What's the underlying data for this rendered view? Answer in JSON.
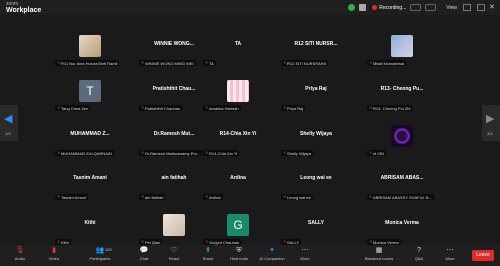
{
  "app": {
    "brand_top": "zoom",
    "brand_bottom": "Workplace"
  },
  "topbar": {
    "recording_label": "Recording...",
    "view_label": "View"
  },
  "colors": {
    "accent": "#2d8cff",
    "muted_mic": "#e23b3b",
    "leave": "#e02b2b",
    "secure": "#2bb24c"
  },
  "pager": {
    "left_page": "1/3",
    "right_page": "3/3"
  },
  "tiles": [
    {
      "center": "",
      "avatar": "photo",
      "label": "R11 Nur Aina Husna Binti Ramli"
    },
    {
      "center": "WINNIE WONG...",
      "avatar": "",
      "label": "WINNIE WONG MING WEI"
    },
    {
      "center": "TA",
      "avatar": "",
      "label": "TA"
    },
    {
      "center": "R12 SITI NURSR...",
      "avatar": "",
      "label": "R12 SITI NURSRAINI"
    },
    {
      "center": "",
      "avatar": "photo",
      "label": "Mitali Khandelwal"
    },
    {
      "center": "",
      "avatar": "T",
      "label": "Tang Chea Zen"
    },
    {
      "center": "Pratishthit Chau...",
      "avatar": "",
      "label": "Pratishthit Chauhan"
    },
    {
      "center": "",
      "avatar": "photo",
      "label": "Amalina Hadirah"
    },
    {
      "center": "Priya Raj",
      "avatar": "",
      "label": "Priya Raj"
    },
    {
      "center": "R13- Cheong Pu...",
      "avatar": "",
      "label": "R13- Cheong Pui Zhi"
    },
    {
      "center": "MUHAMMAD Z...",
      "avatar": "",
      "label": "MUHAMMAD ZULQARNAIN"
    },
    {
      "center": "Dr.Ramesh Mut...",
      "avatar": "",
      "label": "Dr.Ramesh Mathuswamy Pro..."
    },
    {
      "center": "R14-Chia Xin Yi",
      "avatar": "",
      "label": "R14-Chia Xin Yi"
    },
    {
      "center": "Shelly Wijaya",
      "avatar": "",
      "label": "Shelly Wijaya"
    },
    {
      "center": "",
      "avatar": "photo",
      "label": "zt XIN"
    },
    {
      "center": "Tasnim Amani",
      "avatar": "",
      "label": "Tasnim Amani"
    },
    {
      "center": "ain fatihah",
      "avatar": "",
      "label": "ain fatihah"
    },
    {
      "center": "Ardina",
      "avatar": "",
      "label": "Ardina"
    },
    {
      "center": "Leong wai ee",
      "avatar": "",
      "label": "Leong wai ee"
    },
    {
      "center": "ABRISAM ABAS...",
      "avatar": "",
      "label": "ABRISAM ABASSY SHAFUL N..."
    },
    {
      "center": "Kithi",
      "avatar": "",
      "label": "Kithi"
    },
    {
      "center": "",
      "avatar": "photo",
      "label": "Pei Qian"
    },
    {
      "center": "",
      "avatar": "G",
      "label": "Gurjyot Chauhan"
    },
    {
      "center": "SALLY",
      "avatar": "",
      "label": "SALLY"
    },
    {
      "center": "Monica Verma",
      "avatar": "",
      "label": "Monica Verma"
    }
  ],
  "toolbar": {
    "audio": "Audio",
    "video": "Video",
    "participants": "Participants",
    "participants_count": "120",
    "chat": "Chat",
    "react": "React",
    "share": "Share",
    "host_tools": "Host tools",
    "ai_companion": "AI Companion",
    "more1": "More",
    "breakout": "Breakout rooms",
    "qa": "Q&A",
    "more2": "More",
    "leave": "Leave"
  }
}
